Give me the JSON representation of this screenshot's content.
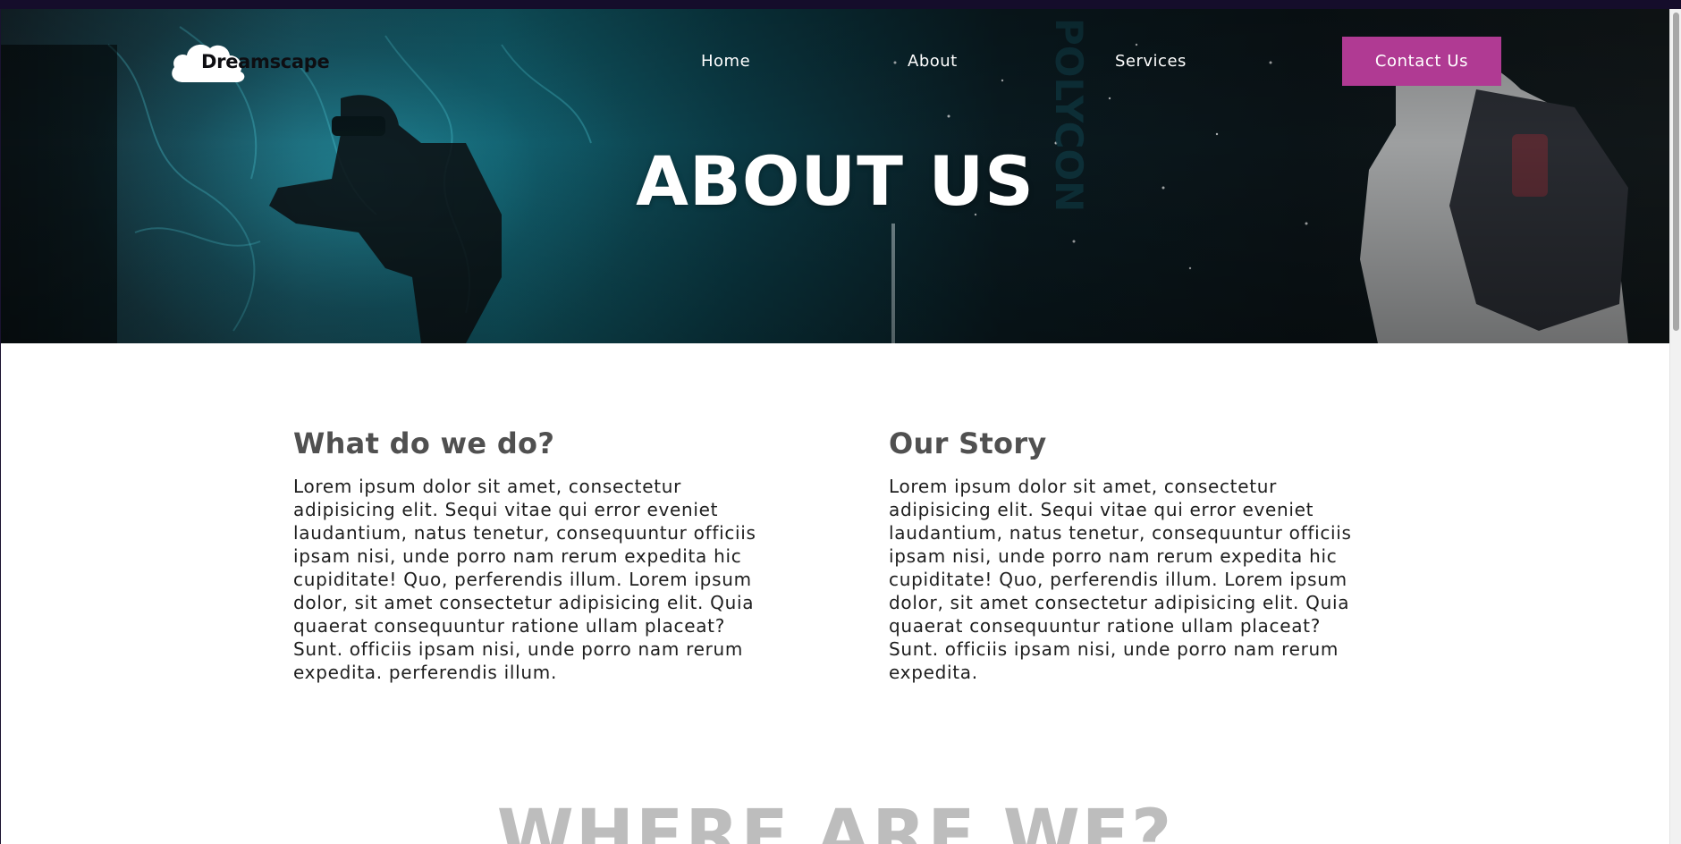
{
  "header": {
    "logo_text": "Dreamscape",
    "nav": {
      "home": "Home",
      "about": "About",
      "services": "Services",
      "contact": "Contact Us"
    },
    "hero_title": "ABOUT US"
  },
  "sections": {
    "left": {
      "title": "What do we do?",
      "body": "Lorem ipsum dolor sit amet, consectetur adipisicing elit. Sequi vitae qui error eveniet laudantium, natus tenetur, consequuntur officiis ipsam nisi, unde porro nam rerum expedita hic cupiditate! Quo, perferendis illum. Lorem ipsum dolor, sit amet consectetur adipisicing elit. Quia quaerat consequuntur ratione ullam placeat? Sunt. officiis ipsam nisi, unde porro nam rerum expedita. perferendis illum."
    },
    "right": {
      "title": "Our Story",
      "body": "Lorem ipsum dolor sit amet, consectetur adipisicing elit. Sequi vitae qui error eveniet laudantium, natus tenetur, consequuntur officiis ipsam nisi, unde porro nam rerum expedita hic cupiditate! Quo, perferendis illum. Lorem ipsum dolor, sit amet consectetur adipisicing elit. Quia quaerat consequuntur ratione ullam placeat? Sunt. officiis ipsam nisi, unde porro nam rerum expedita."
    },
    "next_heading": "WHERE ARE WE?"
  },
  "colors": {
    "accent": "#b03a93",
    "heading_gray": "#505050",
    "faded_heading": "#bdbdbd"
  },
  "icons": {
    "logo": "cloud-icon"
  }
}
